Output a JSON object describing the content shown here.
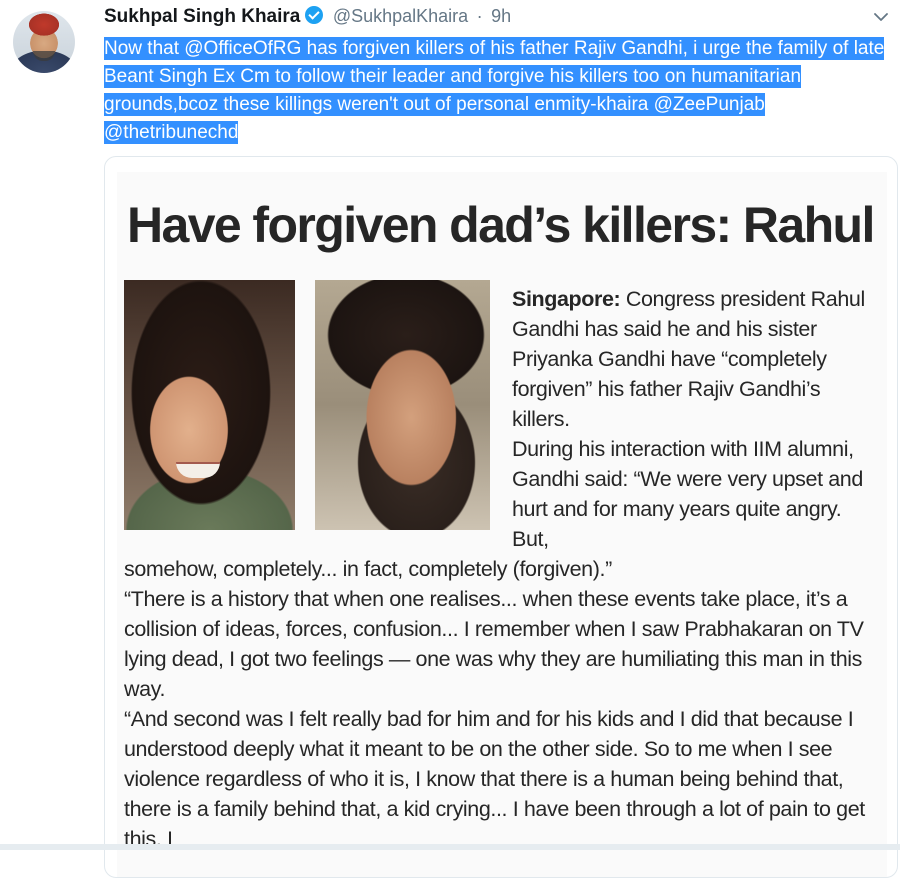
{
  "tweet": {
    "author_name": "Sukhpal Singh Khaira",
    "handle": "@SukhpalKhaira",
    "separator": "·",
    "time": "9h",
    "text": "Now that @OfficeOfRG has forgiven killers of his father Rajiv Gandhi, i urge the family of late Beant Singh Ex Cm to follow their leader and forgive his killers too on humanitarian grounds,bcoz these killings weren't out of personal enmity-khaira @ZeePunjab @thetribunechd"
  },
  "colors": {
    "selection": "#3390ff",
    "verified": "#1da1f2",
    "muted": "#657786"
  },
  "icons": {
    "verified": "verified-badge-icon",
    "menu": "chevron-down-icon"
  },
  "article": {
    "headline": "Have forgiven dad’s killers: Rahul",
    "dateline": "Singapore:",
    "para1": " Congress president Rahul Gandhi has said he and his sister Priyanka Gandhi have “completely forgiven” his father Rajiv Gandhi’s killers.",
    "para2": "During his interaction with IIM alumni, Gandhi said: “We were very upset and hurt and for many years quite angry. But,",
    "para2_cont": "somehow, completely... in fact, completely (forgiven).”",
    "para3": "“There is a history that when one realises... when these events take place, it’s a collision of ideas, forces, confusion... I remember when I saw Prabhakaran on TV lying dead, I got two feelings — one was why they are humiliating this man in this way.",
    "para4": "“And second was I felt really bad for him and for his kids and I did that because I understood deeply what it meant to be on the other side. So to me when I see violence regardless of who it is, I know that there is a human being behind that, there is a family behind that, a kid crying... I have been through a lot of pain to get this. I"
  }
}
